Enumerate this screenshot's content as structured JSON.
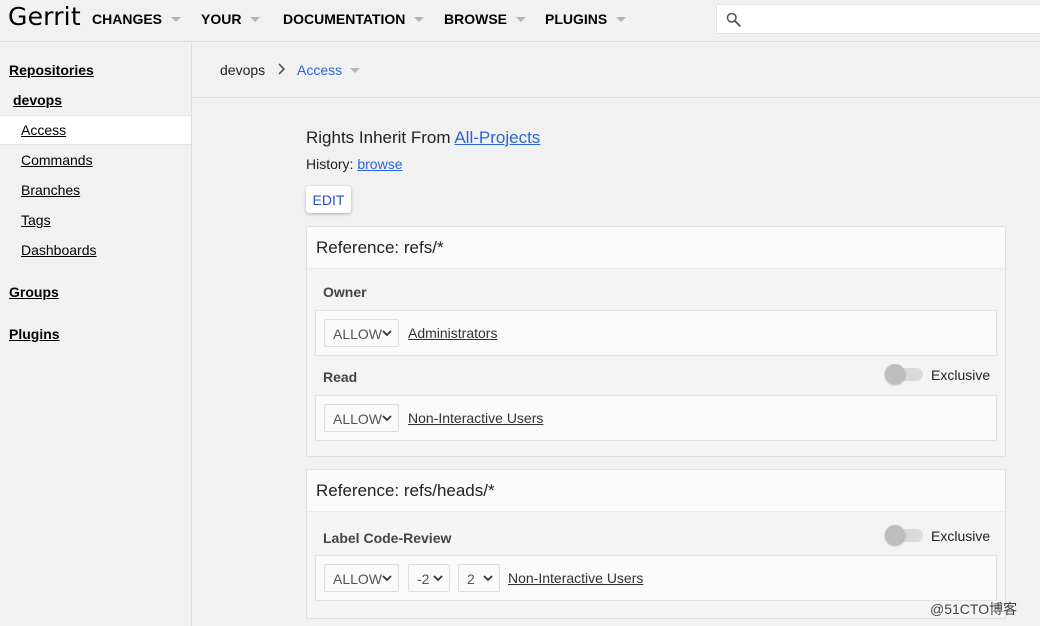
{
  "header": {
    "logo": "Gerrit",
    "nav": [
      "CHANGES",
      "YOUR",
      "DOCUMENTATION",
      "BROWSE",
      "PLUGINS"
    ],
    "search_placeholder": ""
  },
  "sidebar": {
    "repositories": "Repositories",
    "repo": "devops",
    "items": [
      "Access",
      "Commands",
      "Branches",
      "Tags",
      "Dashboards"
    ],
    "groups": "Groups",
    "plugins": "Plugins"
  },
  "breadcrumb": {
    "repo": "devops",
    "page": "Access"
  },
  "main": {
    "inherit_label": "Rights Inherit From",
    "inherit_link": "All-Projects",
    "history_label": "History:",
    "history_link": "browse",
    "edit": "EDIT",
    "refs": [
      {
        "title": "Reference: refs/*",
        "permissions": [
          {
            "name": "Owner",
            "action": "ALLOW",
            "group": "Administrators"
          },
          {
            "name": "Read",
            "exclusive_label": "Exclusive",
            "action": "ALLOW",
            "group": "Non-Interactive Users"
          }
        ]
      },
      {
        "title": "Reference: refs/heads/*",
        "permissions": [
          {
            "name": "Label Code-Review",
            "exclusive_label": "Exclusive",
            "action": "ALLOW",
            "min": "-2",
            "max": "2",
            "group": "Non-Interactive Users"
          }
        ]
      }
    ]
  },
  "watermark": "@51CTO博客",
  "colors": {
    "link": "#2a66d9",
    "edit": "#2a4fc8",
    "background": "#f1f1f1"
  }
}
